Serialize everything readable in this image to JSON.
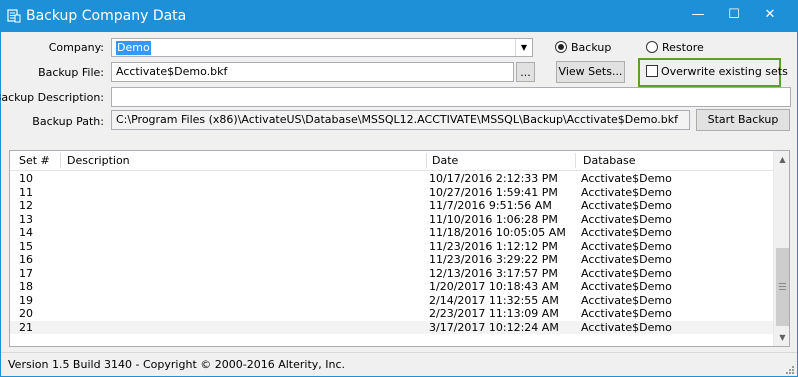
{
  "window": {
    "title": "Backup Company Data",
    "controls": {
      "minimize": "—",
      "maximize": "☐",
      "close": "✕"
    }
  },
  "form": {
    "company": {
      "label": "Company:",
      "value": "Demo"
    },
    "backup_file": {
      "label": "Backup File:",
      "value": "Acctivate$Demo.bkf",
      "browse_label": "..."
    },
    "backup_description": {
      "label": "Backup Description:",
      "value": ""
    },
    "backup_path": {
      "label": "Backup Path:",
      "value": "C:\\Program Files (x86)\\ActivateUS\\Database\\MSSQL12.ACCTIVATE\\MSSQL\\Backup\\Acctivate$Demo.bkf"
    },
    "mode": {
      "backup_label": "Backup",
      "restore_label": "Restore",
      "selected": "Backup"
    },
    "view_sets_label": "View Sets...",
    "overwrite_label": "Overwrite existing sets",
    "overwrite_checked": false,
    "start_backup_label": "Start Backup"
  },
  "table": {
    "columns": [
      "Set #",
      "Description",
      "Date",
      "Database"
    ],
    "rows": [
      {
        "set": "10",
        "description": "",
        "date": "10/17/2016 2:12:33 PM",
        "database": "Acctivate$Demo"
      },
      {
        "set": "11",
        "description": "",
        "date": "10/27/2016 1:59:41 PM",
        "database": "Acctivate$Demo"
      },
      {
        "set": "12",
        "description": "",
        "date": "11/7/2016 9:51:56 AM",
        "database": "Acctivate$Demo"
      },
      {
        "set": "13",
        "description": "",
        "date": "11/10/2016 1:06:28 PM",
        "database": "Acctivate$Demo"
      },
      {
        "set": "14",
        "description": "",
        "date": "11/18/2016 10:05:05 AM",
        "database": "Acctivate$Demo"
      },
      {
        "set": "15",
        "description": "",
        "date": "11/23/2016 1:12:12 PM",
        "database": "Acctivate$Demo"
      },
      {
        "set": "16",
        "description": "",
        "date": "11/23/2016 3:29:22 PM",
        "database": "Acctivate$Demo"
      },
      {
        "set": "17",
        "description": "",
        "date": "12/13/2016 3:17:57 PM",
        "database": "Acctivate$Demo"
      },
      {
        "set": "18",
        "description": "",
        "date": "1/20/2017 10:18:43 AM",
        "database": "Acctivate$Demo"
      },
      {
        "set": "19",
        "description": "",
        "date": "2/14/2017 11:32:55 AM",
        "database": "Acctivate$Demo"
      },
      {
        "set": "20",
        "description": "",
        "date": "2/23/2017 11:13:09 AM",
        "database": "Acctivate$Demo"
      },
      {
        "set": "21",
        "description": "",
        "date": "3/17/2017 10:12:24 AM",
        "database": "Acctivate$Demo"
      }
    ],
    "selected_row": "21"
  },
  "status": {
    "text": "Version 1.5 Build 3140 - Copyright © 2000-2016 Alterity, Inc."
  },
  "colors": {
    "titlebar": "#1e90d8",
    "highlight_border": "#5aa02c",
    "selection": "#3399ff"
  },
  "icons": [
    "app-icon",
    "chevron-down-icon",
    "scroll-up-icon",
    "scroll-down-icon",
    "size-grip-icon"
  ]
}
